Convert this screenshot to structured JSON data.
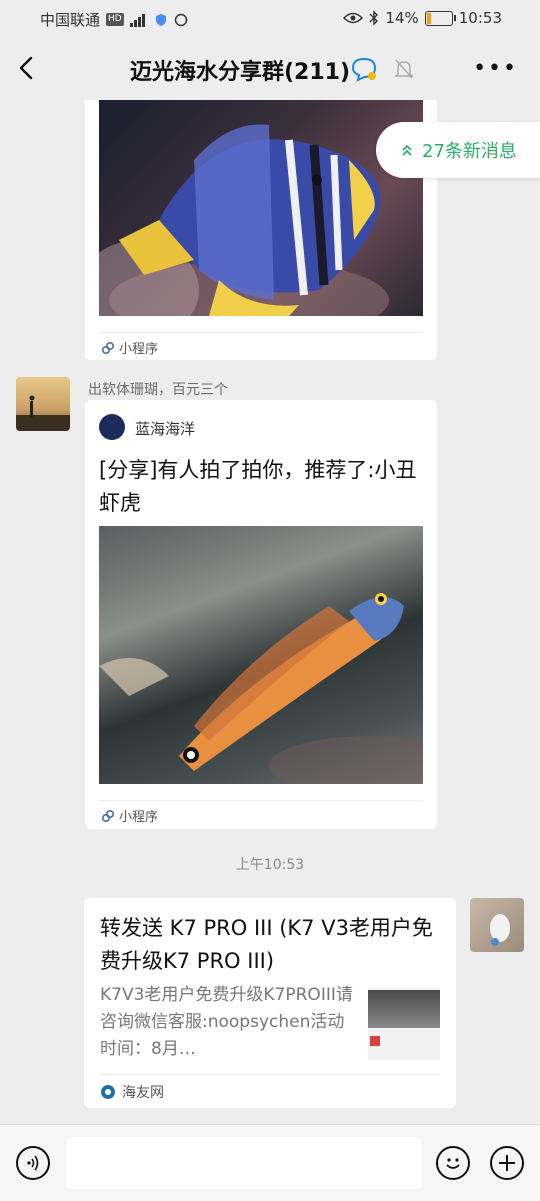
{
  "status": {
    "carrier": "中国联通",
    "hd": "HD",
    "battery_pct": "14%",
    "time": "10:53"
  },
  "chat": {
    "title": "迈光海水分享群(211)",
    "new_messages": "27条新消息"
  },
  "messages": [
    {
      "type": "mini-program-card",
      "app_label": "小程序"
    },
    {
      "sender_caption": "出软体珊瑚，百元三个",
      "card": {
        "source": "蓝海海洋",
        "title": "[分享]有人拍了拍你，推荐了:小丑虾虎",
        "app_label": "小程序"
      }
    },
    {
      "time": "上午10:53"
    },
    {
      "card": {
        "title": "转发送 K7 PRO III (K7 V3老用户免费升级K7 PRO III)",
        "desc": "K7V3老用户免费升级K7PROIII请咨询微信客服:noopsychen活动时间：8月…",
        "source": "海友网"
      }
    }
  ],
  "colors": {
    "accent": "#2aae67",
    "bg": "#ededed"
  }
}
